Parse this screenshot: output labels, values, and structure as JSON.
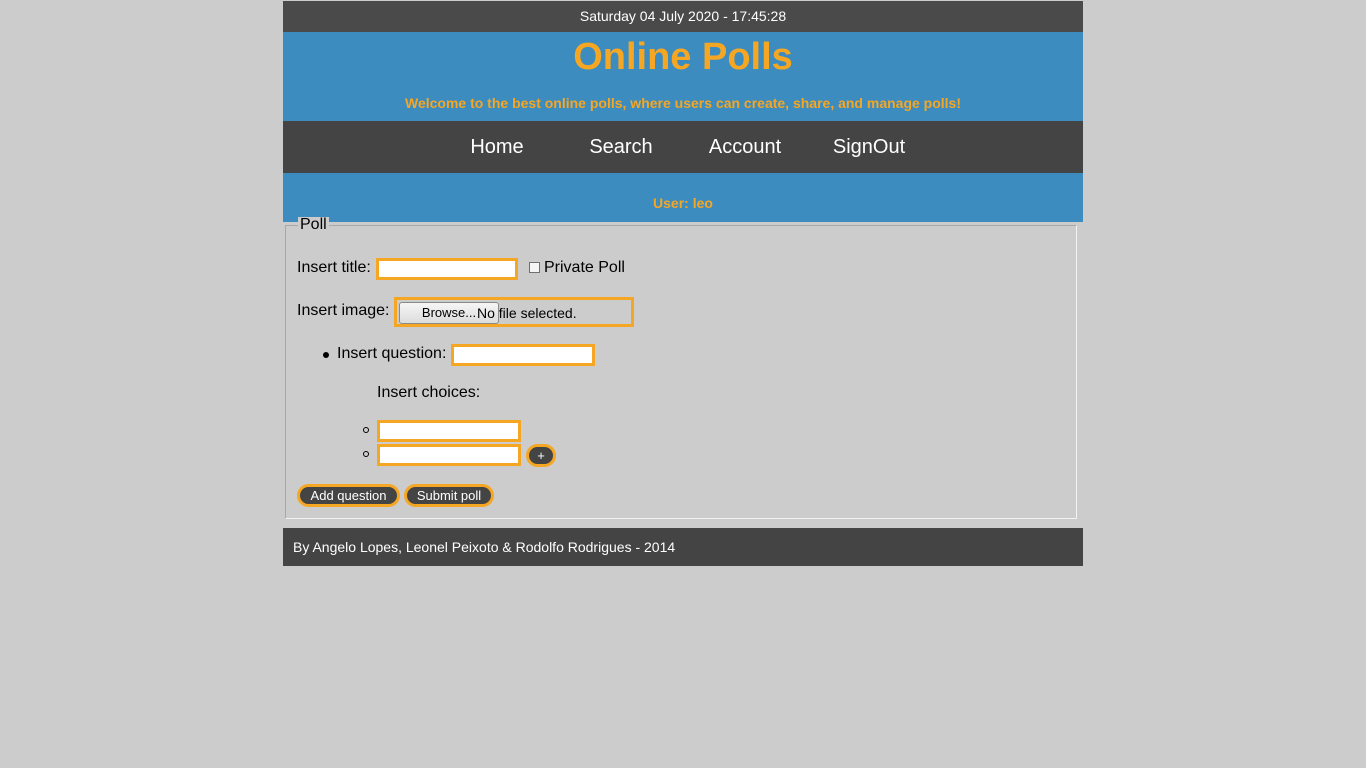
{
  "datebar": {
    "text": "Saturday 04 July 2020 - 17:45:28"
  },
  "header": {
    "title": "Online Polls",
    "subtitle": "Welcome to the best online polls, where users can create, share, and manage polls!"
  },
  "nav": {
    "items": [
      {
        "label": "Home"
      },
      {
        "label": "Search"
      },
      {
        "label": "Account"
      },
      {
        "label": "SignOut"
      }
    ]
  },
  "user": {
    "text": "User: leo"
  },
  "poll": {
    "legend": "Poll",
    "title_label": "Insert title:",
    "title_value": "",
    "private_label": "Private Poll",
    "private_checked": false,
    "image_label": "Insert image:",
    "browse_label": "Browse...",
    "file_status": "No file selected.",
    "question_label": "Insert question:",
    "question_value": "",
    "choices_label": "Insert choices:",
    "choices": [
      "",
      ""
    ],
    "add_choice_label": "+",
    "add_question_label": "Add question",
    "submit_label": "Submit poll"
  },
  "footer": {
    "text": "By Angelo Lopes, Leonel Peixoto & Rodolfo Rodrigues - 2014"
  },
  "colors": {
    "accent": "#f5a623",
    "header_blue": "#3d8cc0",
    "dark_bar": "#444444",
    "page_bg": "#cccccc"
  }
}
